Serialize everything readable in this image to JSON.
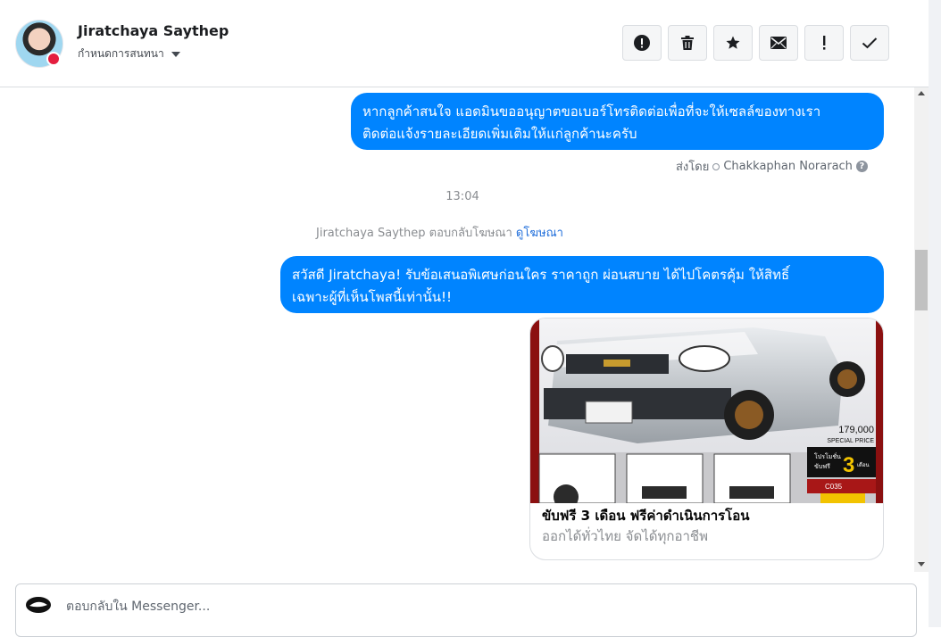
{
  "header": {
    "contact_name": "Jiratchaya Saythep",
    "assign_label": "กำหนดการสนทนา",
    "actions": [
      {
        "icon": "alert-circle-icon",
        "label": "Mark as spam"
      },
      {
        "icon": "trash-icon",
        "label": "Delete"
      },
      {
        "icon": "star-icon",
        "label": "Star"
      },
      {
        "icon": "envelope-icon",
        "label": "Mark as unread"
      },
      {
        "icon": "exclamation-icon",
        "label": "Follow up"
      },
      {
        "icon": "check-icon",
        "label": "Mark as done"
      }
    ]
  },
  "thread": {
    "message1": {
      "line1": "หากลูกค้าสนใจ แอดมินขออนุญาตขอเบอร์โทรติดต่อเพื่อที่จะให้เซลล์ของทางเรา",
      "line2": "ติดต่อแจ้งรายละเอียดเพิ่มเติมให้แก่ลูกค้านะครับ"
    },
    "sent_by_label": "ส่งโดย",
    "sent_by_agent": "Chakkaphan Norarach",
    "timestamp": "13:04",
    "ad_reply_text": "Jiratchaya Saythep ตอบกลับโฆษณา",
    "ad_reply_link": "ดูโฆษณา",
    "message2": {
      "line1": "สวัสดี Jiratchaya! รับข้อเสนอพิเศษก่อนใคร ราคาถูก ผ่อนสบาย ได้ไปโคตรคุ้ม ให้สิทธิ์",
      "line2": "เฉพาะผู้ที่เห็นโพสนี้เท่านั้น!!"
    },
    "card": {
      "title": "ขับฟรี 3 เดือน ฟรีค่าดำเนินการโอน",
      "subtitle": "ออกได้ทั่วไทย จัดได้ทุกอาชีพ",
      "price": "179,000",
      "price_label": "SPECIAL PRICE",
      "promo_prefix": "โปรโมชั่น",
      "promo_free": "ขับฟรี",
      "promo_number": "3",
      "promo_unit": "เดือน",
      "code": "C035"
    }
  },
  "composer": {
    "placeholder": "ตอบกลับใน Messenger..."
  },
  "colors": {
    "bubble": "#0084ff",
    "link": "#216fdb"
  }
}
